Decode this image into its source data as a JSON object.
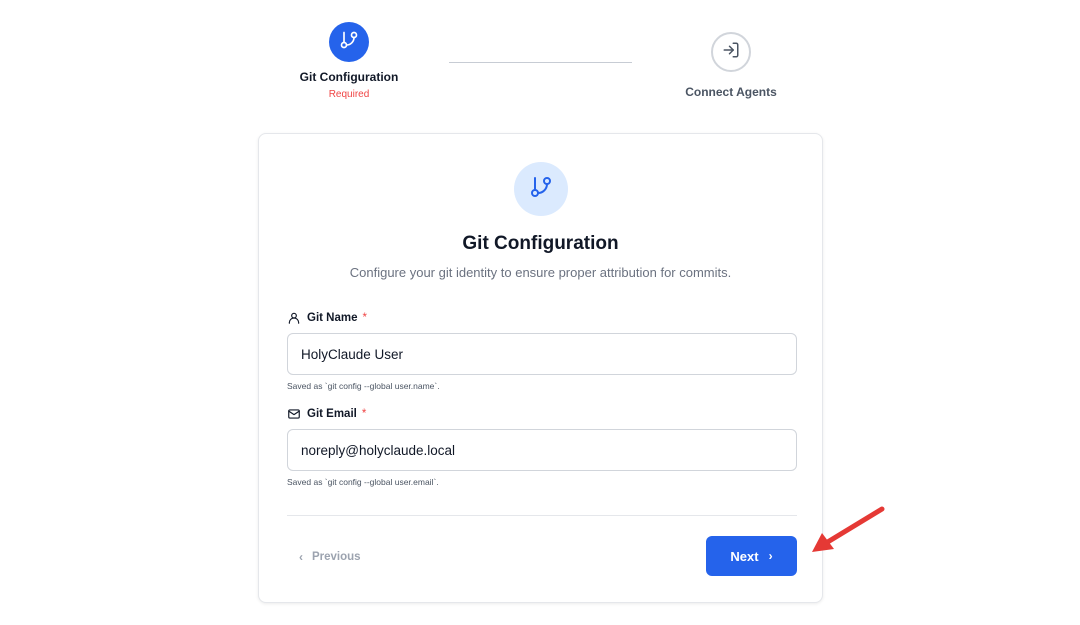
{
  "stepper": {
    "steps": [
      {
        "title": "Git Configuration",
        "subtitle": "Required",
        "icon": "git-branch-icon",
        "state": "active"
      },
      {
        "title": "Connect Agents",
        "subtitle": "",
        "icon": "sign-in-arrow-icon",
        "state": "inactive"
      }
    ]
  },
  "card": {
    "icon": "git-branch-icon",
    "title": "Git Configuration",
    "description": "Configure your git identity to ensure proper attribution for commits.",
    "fields": [
      {
        "label": "Git Name",
        "required_mark": "*",
        "icon": "user-icon",
        "value": "HolyClaude User",
        "hint": "Saved as `git config --global user.name`."
      },
      {
        "label": "Git Email",
        "required_mark": "*",
        "icon": "mail-icon",
        "value": "noreply@holyclaude.local",
        "hint": "Saved as `git config --global user.email`."
      }
    ],
    "previous_label": "Previous",
    "next_label": "Next"
  },
  "colors": {
    "accent": "#2563eb",
    "required": "#ef4444",
    "annotation_arrow": "#e53935"
  }
}
